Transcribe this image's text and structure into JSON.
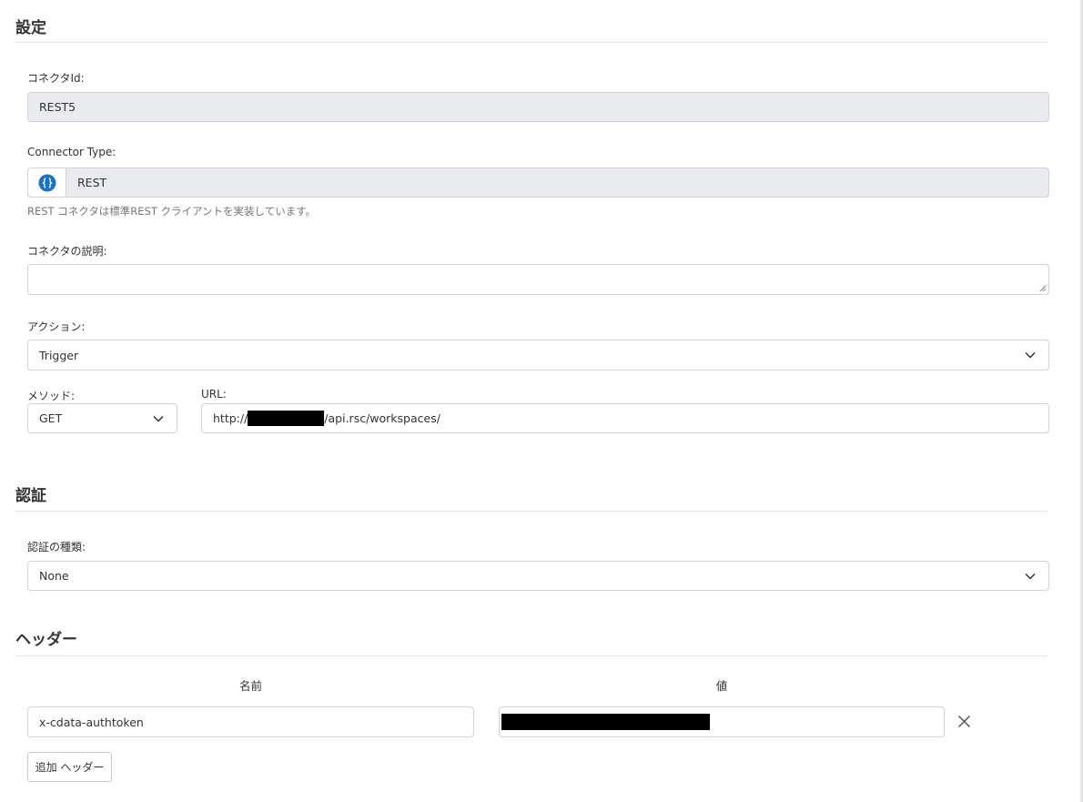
{
  "settings": {
    "title": "設定",
    "connector_id_label": "コネクタId:",
    "connector_id_value": "REST5",
    "connector_type_label": "Connector Type:",
    "connector_type_value": "REST",
    "connector_type_icon": "braces-icon",
    "connector_type_help": "REST コネクタは標準REST クライアントを実装しています。",
    "description_label": "コネクタの説明:",
    "description_value": "",
    "action_label": "アクション:",
    "action_value": "Trigger",
    "method_label": "メソッド:",
    "method_value": "GET",
    "url_label": "URL:",
    "url_prefix": "http://",
    "url_suffix": "/api.rsc/workspaces/"
  },
  "auth": {
    "title": "認証",
    "type_label": "認証の種類:",
    "type_value": "None"
  },
  "headers": {
    "title": "ヘッダー",
    "name_column": "名前",
    "value_column": "値",
    "rows": [
      {
        "name": "x-cdata-authtoken"
      }
    ],
    "add_button": "追加 ヘッダー"
  },
  "colors": {
    "accent": "#1a73c8",
    "readonly_bg": "#e9ebee",
    "border": "#cfd4da"
  }
}
